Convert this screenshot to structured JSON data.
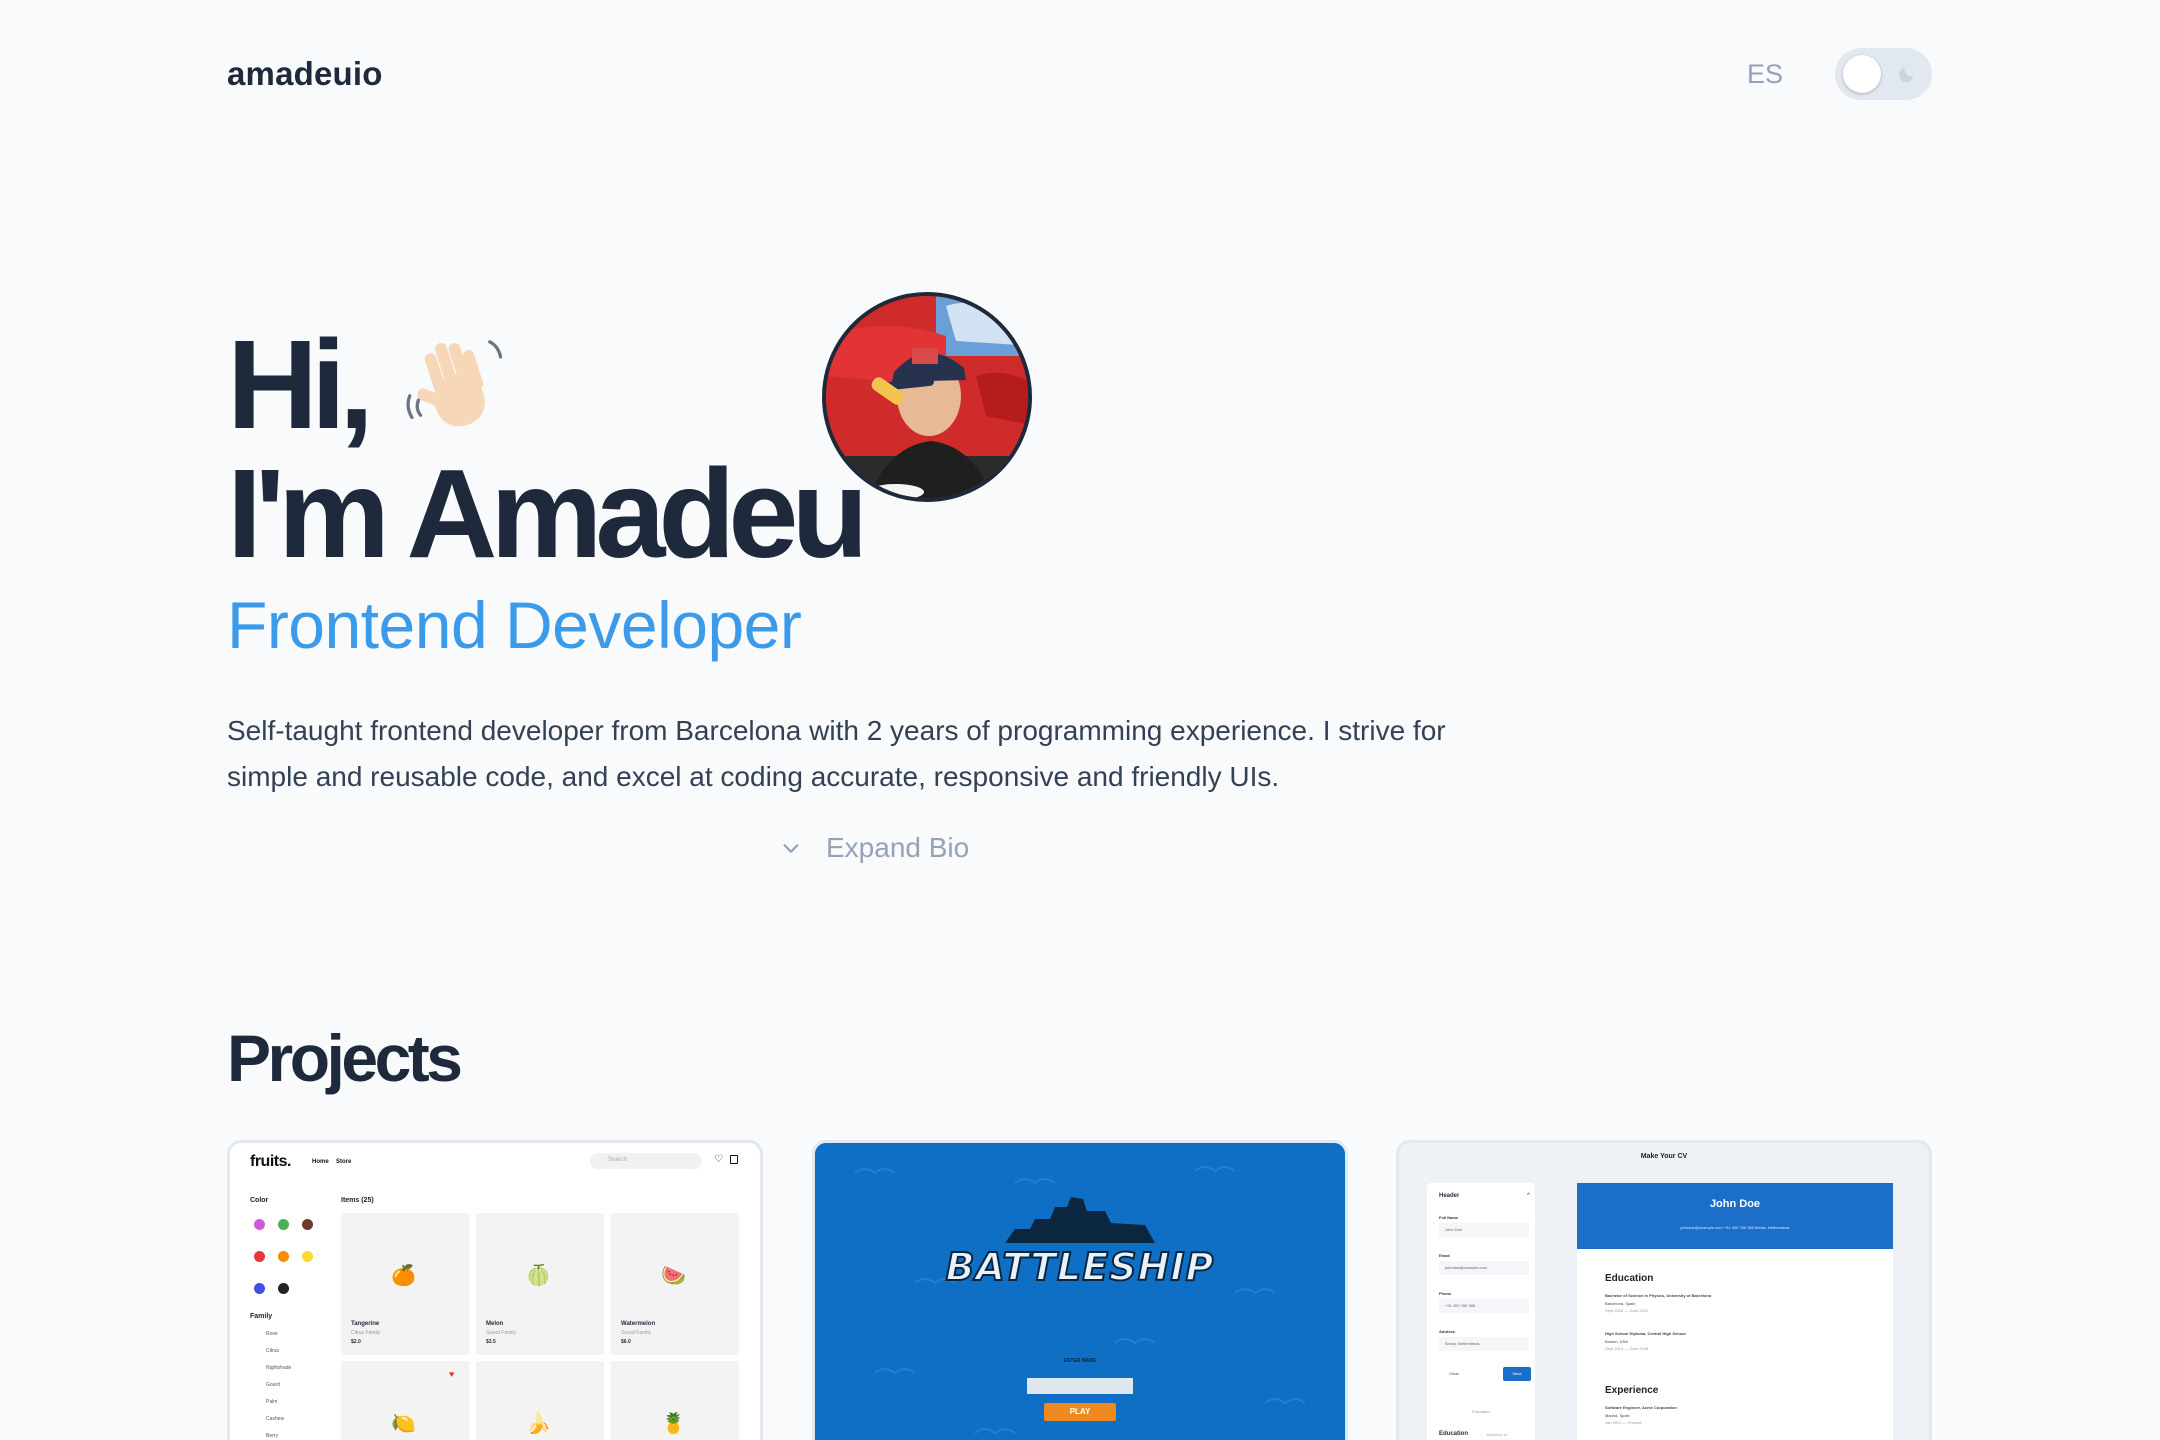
{
  "header": {
    "logo": "amadeuio",
    "language_button": "ES",
    "theme_toggle": {
      "icon": "moon-icon",
      "state": "light"
    }
  },
  "hero": {
    "greeting": "Hi,",
    "greeting_icon": "waving-hand-icon",
    "name_line": "I'm Amadeu",
    "role": "Frontend Developer",
    "avatar_alt": "avatar",
    "bio": "Self-taught frontend developer from Barcelona with 2 years of programming experience. I strive for simple and reusable code, and excel at coding accurate, responsive and friendly UIs.",
    "expand_label": "Expand Bio"
  },
  "projects": {
    "title": "Projects",
    "fruits": {
      "logo": "fruits.",
      "nav": [
        "Home",
        "Store"
      ],
      "search_placeholder": "Search",
      "color_label": "Color",
      "colors": [
        {
          "name": "Purple",
          "hex": "#d05ad6"
        },
        {
          "name": "Green",
          "hex": "#4caf50"
        },
        {
          "name": "Brown",
          "hex": "#6d3b2e"
        },
        {
          "name": "Red",
          "hex": "#e53935"
        },
        {
          "name": "Orange",
          "hex": "#fb8c00"
        },
        {
          "name": "Yellow",
          "hex": "#fdd835"
        },
        {
          "name": "Blue",
          "hex": "#3f51e5"
        },
        {
          "name": "Black",
          "hex": "#222222"
        }
      ],
      "family_label": "Family",
      "families": [
        "Rose",
        "Citrus",
        "Nightshade",
        "Gourd",
        "Palm",
        "Cashew",
        "Berry"
      ],
      "items_label": "Items (25)",
      "items": [
        {
          "name": "Tangerine",
          "family": "Citrus Family",
          "price": "$2.0",
          "emoji": "🍊"
        },
        {
          "name": "Melon",
          "family": "Gourd Family",
          "price": "$3.5",
          "emoji": "🍈"
        },
        {
          "name": "Watermelon",
          "family": "Gourd Family",
          "price": "$6.0",
          "emoji": "🍉"
        },
        {
          "name": "",
          "family": "",
          "price": "",
          "emoji": "🍋"
        },
        {
          "name": "",
          "family": "",
          "price": "",
          "emoji": "🍌"
        },
        {
          "name": "",
          "family": "",
          "price": "",
          "emoji": "🍍"
        }
      ]
    },
    "battleship": {
      "title": "BATTLESHIP",
      "enter_label": "ENTER NAME",
      "play_label": "PLAY"
    },
    "cv": {
      "heading": "Make Your CV",
      "form_header": "Header",
      "fields": [
        {
          "label": "Full Name",
          "value": "John Doe"
        },
        {
          "label": "Email",
          "value": "johndoe@example.com"
        },
        {
          "label": "Phone",
          "value": "+31 400 766 385"
        },
        {
          "label": "Address",
          "value": "Breda, Netherlands"
        }
      ],
      "clear_label": "Clear",
      "save_label": "Save",
      "education_form_label": "Education",
      "education_form_value": "Bachelor of",
      "education_tab": "Education",
      "name": "John Doe",
      "contact": "johndoe@example.com   +31 400 766 385   Breda, Netherlands",
      "education_title": "Education",
      "education_lines": [
        "Bachelor of Science in Physics, University of Barcelona",
        "Barcelona, Spain",
        "Sept 2018 — June 2021",
        "High School Diploma, Central High School",
        "Boston, USA",
        "Sept 2013 — June 2018"
      ],
      "experience_title": "Experience",
      "experience_lines": [
        "Software Engineer, Acme Corporation",
        "Madrid, Spain",
        "Jan 2021 — Present"
      ]
    }
  }
}
